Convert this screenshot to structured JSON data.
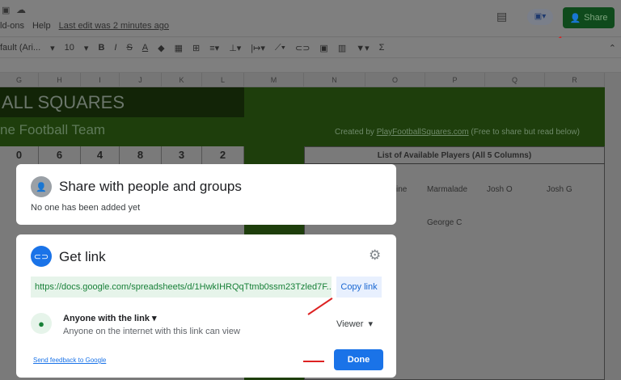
{
  "menu": {
    "addons": "ld-ons",
    "help": "Help",
    "last_edit": "Last edit was 2 minutes ago"
  },
  "share_button": "Share",
  "toolbar": {
    "font": "fault (Ari...",
    "size": "10",
    "bold": "B",
    "italic": "I",
    "strike": "S",
    "textcolor": "A",
    "sum": "Σ"
  },
  "columns": [
    "G",
    "H",
    "I",
    "J",
    "K",
    "L",
    "M",
    "N",
    "O",
    "P",
    "Q",
    "R"
  ],
  "sheet": {
    "title": "ALL SQUARES",
    "subtitle": "ne Football Team",
    "created_prefix": "Created by ",
    "created_link": "PlayFootballSquares.com",
    "created_suffix": " (Free to share but read below)",
    "numbers": [
      "0",
      "6",
      "4",
      "8",
      "3",
      "2"
    ],
    "list_header": "List of Available Players (All 5 Columns)",
    "players": [
      "ine",
      "Marmalade",
      "Josh O",
      "Josh G",
      "George C"
    ]
  },
  "share_dialog": {
    "title": "Share with people and groups",
    "empty": "No one has been added yet"
  },
  "link_dialog": {
    "title": "Get link",
    "url": "https://docs.google.com/spreadsheets/d/1HwkIHRQqTtmb0ssm23Tzled7F...",
    "copy": "Copy link",
    "access": "Anyone with the link",
    "access_desc": "Anyone on the internet with this link can view",
    "role": "Viewer",
    "feedback": "Send feedback to Google",
    "done": "Done"
  },
  "colors": {
    "accent": "#1a73e8",
    "share_green": "#0f4a1c",
    "link_bg": "#e6f4ea",
    "link_text": "#188038"
  }
}
